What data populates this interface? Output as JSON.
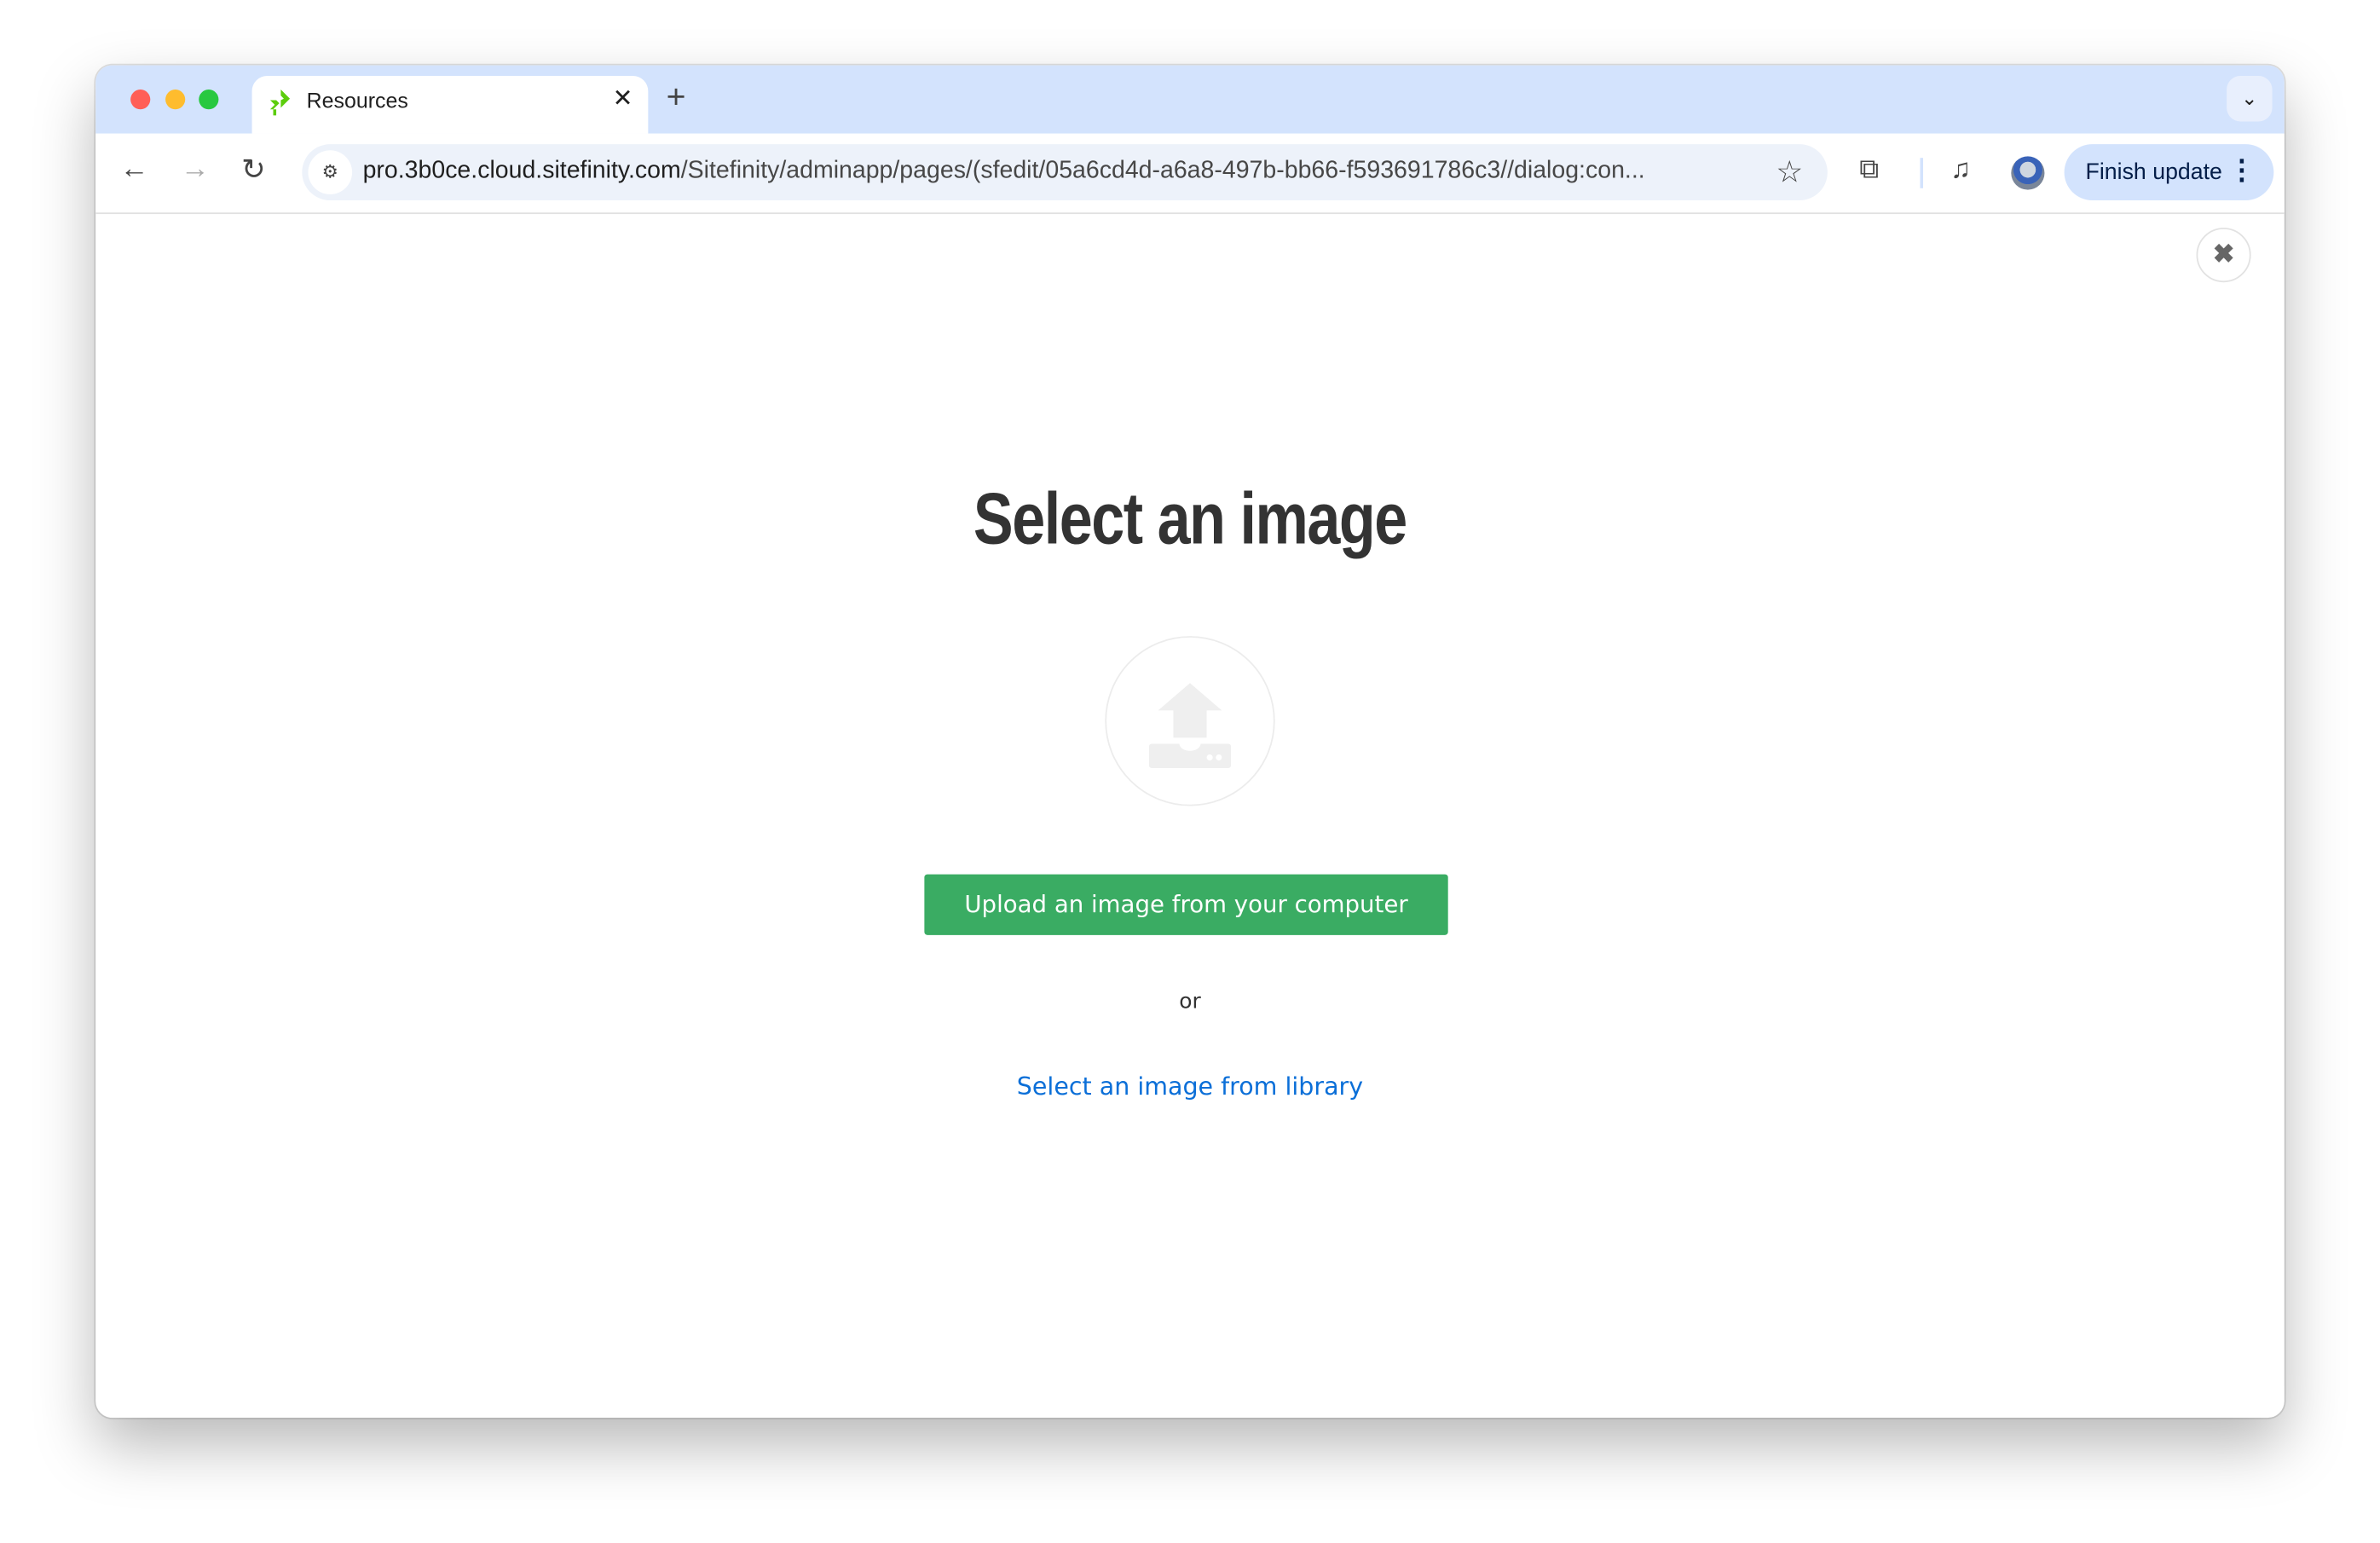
{
  "browser": {
    "tab": {
      "title": "Resources",
      "favicon": "sitefinity-logo-icon",
      "close_glyph": "✕"
    },
    "new_tab_glyph": "+",
    "tab_menu_glyph": "⌄",
    "address": {
      "host": "pro.3b0ce.cloud.sitefinity.com",
      "path": "/Sitefinity/adminapp/pages/(sfedit/05a6cd4d-a6a8-497b-bb66-f593691786c3//dialog:con..."
    },
    "finish_update_label": "Finish update",
    "colors": {
      "tabstrip": "#d3e3fd",
      "omnibox": "#edf2fa"
    }
  },
  "dialog": {
    "title": "Select an image",
    "upload_button": "Upload an image from your computer",
    "or_text": "or",
    "library_link": "Select an image from library",
    "close_glyph": "✖",
    "colors": {
      "upload_button": "#3aac63",
      "link": "#0b6fd8"
    }
  }
}
